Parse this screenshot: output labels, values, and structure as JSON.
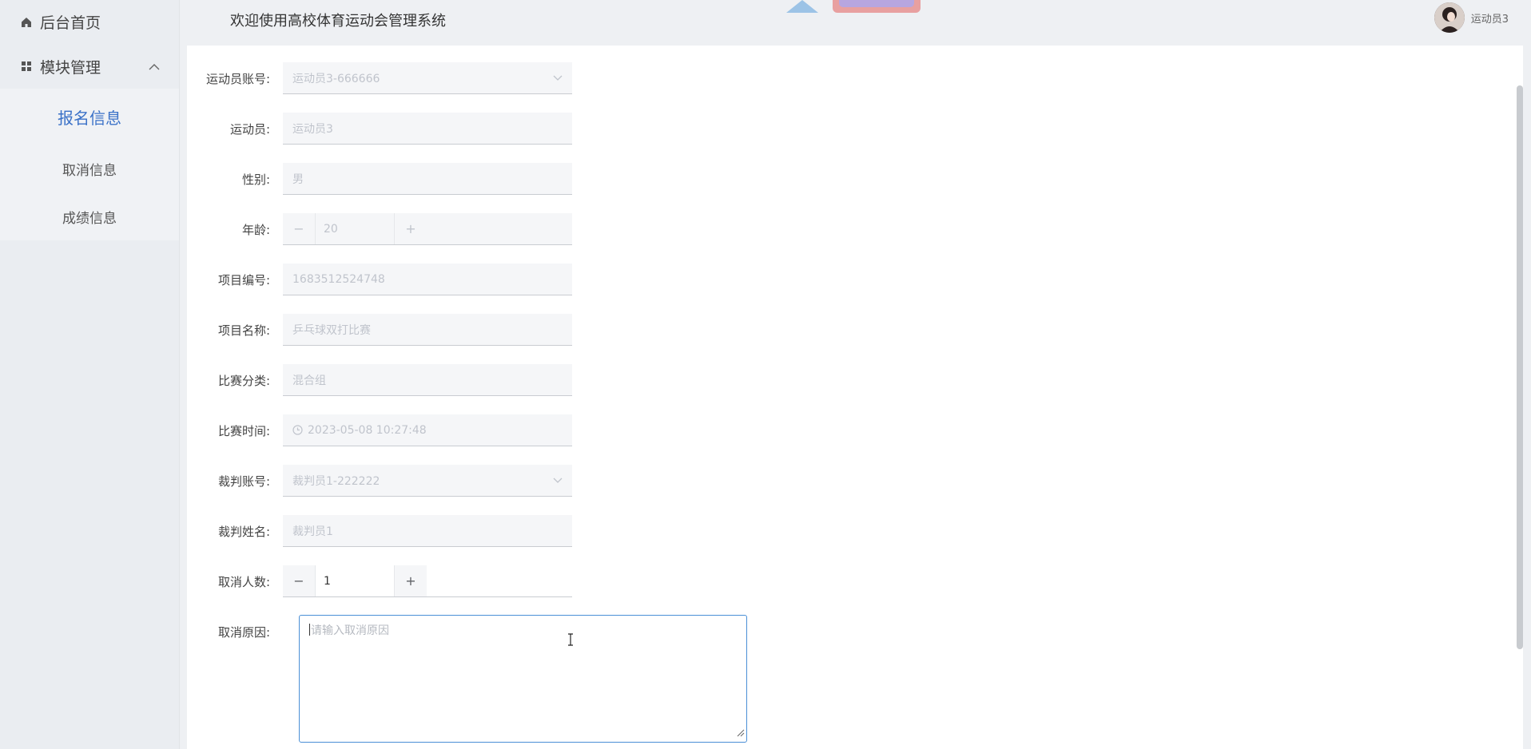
{
  "sidebar": {
    "home": {
      "label": "后台首页",
      "icon": "home-icon"
    },
    "module": {
      "label": "模块管理",
      "icon": "grid-icon",
      "chevron": "chevron-up-icon"
    },
    "items": [
      {
        "label": "报名信息",
        "active": true
      },
      {
        "label": "取消信息",
        "active": false
      },
      {
        "label": "成绩信息",
        "active": false
      }
    ]
  },
  "header": {
    "title": "欢迎使用高校体育运动会管理系统",
    "username": "运动员3"
  },
  "form": {
    "fields": [
      {
        "label": "运动员账号:",
        "value": "运动员3-666666",
        "type": "select"
      },
      {
        "label": "运动员:",
        "value": "运动员3",
        "type": "text"
      },
      {
        "label": "性别:",
        "value": "男",
        "type": "text"
      },
      {
        "label": "年龄:",
        "value": "20",
        "type": "stepper"
      },
      {
        "label": "项目编号:",
        "value": "1683512524748",
        "type": "text"
      },
      {
        "label": "项目名称:",
        "value": "乒乓球双打比赛",
        "type": "text"
      },
      {
        "label": "比赛分类:",
        "value": "混合组",
        "type": "text"
      },
      {
        "label": "比赛时间:",
        "value": "2023-05-08 10:27:48",
        "type": "datetime"
      },
      {
        "label": "裁判账号:",
        "value": "裁判员1-222222",
        "type": "select"
      },
      {
        "label": "裁判姓名:",
        "value": "裁判员1",
        "type": "text"
      },
      {
        "label": "取消人数:",
        "value": "1",
        "type": "stepper-enabled"
      },
      {
        "label": "取消原因:",
        "placeholder": "请输入取消原因",
        "type": "textarea"
      }
    ],
    "stepper_minus": "−",
    "stepper_plus": "+"
  },
  "colors": {
    "accent": "#3b72c8",
    "focus_border": "#4a8fd6",
    "sidebar_bg": "#eaedf1"
  }
}
